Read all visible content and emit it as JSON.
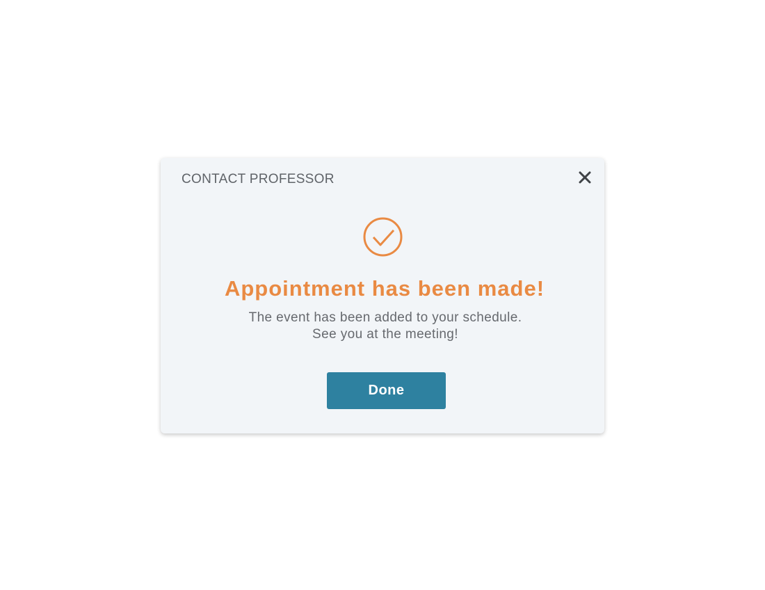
{
  "dialog": {
    "title": "CONTACT PROFESSOR",
    "close_icon": "close-icon",
    "status_icon": "check-circle-icon",
    "heading": "Appointment has been made!",
    "message_line1": "The event has been added to your schedule.",
    "message_line2": "See you at the meeting!",
    "done_label": "Done"
  },
  "colors": {
    "accent": "#e98a43",
    "primary_button": "#2e81a0",
    "dialog_background": "#f2f5f8",
    "title_text": "#5f6368",
    "body_text": "#66696e"
  }
}
